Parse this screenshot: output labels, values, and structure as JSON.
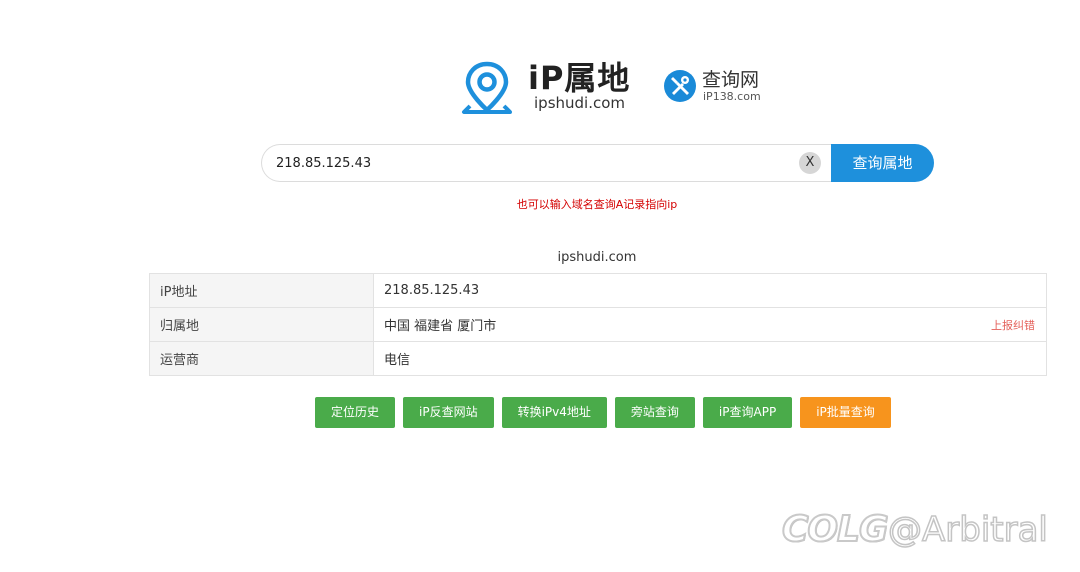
{
  "brand": {
    "title": "iP属地",
    "domain": "ipshudi.com",
    "colors": {
      "pin": "#1e90dc",
      "title": "#222222"
    }
  },
  "partner": {
    "title": "查询网",
    "domain": "iP138.com",
    "color": "#1a8ad8"
  },
  "search": {
    "value": "218.85.125.43",
    "clear_label": "X",
    "button_label": "查询属地",
    "button_color": "#1e90dc",
    "hint": "也可以输入域名查询A记录指向ip"
  },
  "result": {
    "caption": "ipshudi.com",
    "rows": [
      {
        "label": "iP地址",
        "value": "218.85.125.43"
      },
      {
        "label": "归属地",
        "value": "中国 福建省 厦门市",
        "action": "上报纠错"
      },
      {
        "label": "运营商",
        "value": "电信"
      }
    ]
  },
  "actions": [
    {
      "label": "定位历史",
      "color": "green"
    },
    {
      "label": "iP反查网站",
      "color": "green"
    },
    {
      "label": "转换iPv4地址",
      "color": "green"
    },
    {
      "label": "旁站查询",
      "color": "green"
    },
    {
      "label": "iP查询APP",
      "color": "green"
    },
    {
      "label": "iP批量查询",
      "color": "orange"
    }
  ],
  "watermark": {
    "logo": "COLG",
    "user": "@Arbitral"
  }
}
